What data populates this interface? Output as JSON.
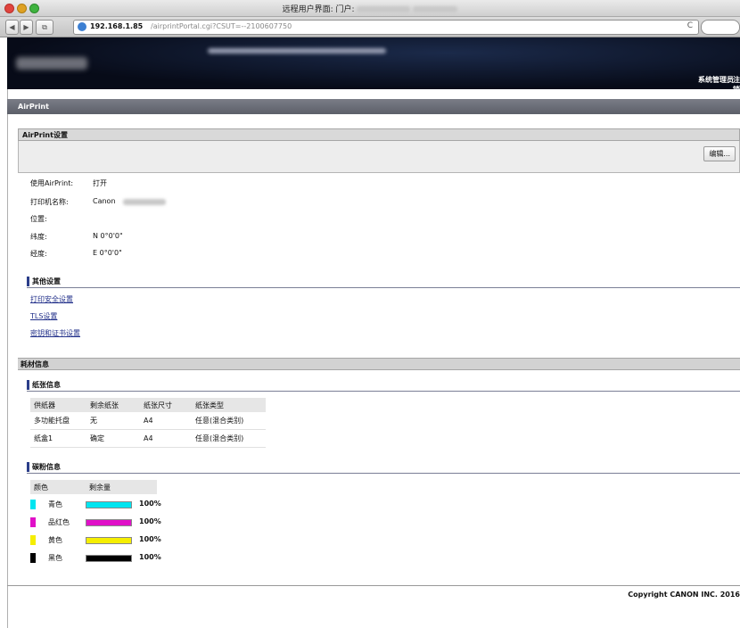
{
  "browser": {
    "window_title": "远程用户界面: 门户:",
    "url_host": "192.168.1.85",
    "url_path": "/airprintPortal.cgi?CSUT=--2100607750",
    "reload_label": "C",
    "back_label": "◀",
    "forward_label": "▶",
    "tabs_label": "⧉"
  },
  "header": {
    "sysadmin_label": "系统管理员",
    "logout_label": "注销"
  },
  "page": {
    "section_title": "AirPrint",
    "settings_panel": {
      "title": "AirPrint设置",
      "edit_button": "编辑...",
      "rows": [
        {
          "label": "使用AirPrint:",
          "value": "打开"
        },
        {
          "label": "打印机名称:",
          "value": "Canon"
        },
        {
          "label": "位置:",
          "value": ""
        },
        {
          "label": "纬度:",
          "value": "N 0°0'0\""
        },
        {
          "label": "经度:",
          "value": "E 0°0'0\""
        }
      ]
    },
    "other_settings": {
      "title": "其他设置",
      "links": [
        "打印安全设置",
        "TLS设置",
        "密钥和证书设置"
      ]
    },
    "consumables": {
      "title": "耗材信息",
      "paper": {
        "title": "纸张信息",
        "headers": [
          "供纸器",
          "剩余纸张",
          "纸张尺寸",
          "纸张类型"
        ],
        "rows": [
          [
            "多功能托盘",
            "无",
            "A4",
            "任意(混合类别)"
          ],
          [
            "纸盒1",
            "确定",
            "A4",
            "任意(混合类别)"
          ]
        ]
      },
      "toner": {
        "title": "碳粉信息",
        "headers": [
          "颜色",
          "剩余量"
        ],
        "rows": [
          {
            "name": "青色",
            "color": "#00e5f0",
            "percent": "100%",
            "level": 1.0
          },
          {
            "name": "品红色",
            "color": "#e010c8",
            "percent": "100%",
            "level": 1.0
          },
          {
            "name": "黄色",
            "color": "#f5ee00",
            "percent": "100%",
            "level": 1.0
          },
          {
            "name": "黑色",
            "color": "#000000",
            "percent": "100%",
            "level": 1.0
          }
        ]
      }
    }
  },
  "footer": {
    "copyright": "Copyright CANON INC. 2016"
  }
}
